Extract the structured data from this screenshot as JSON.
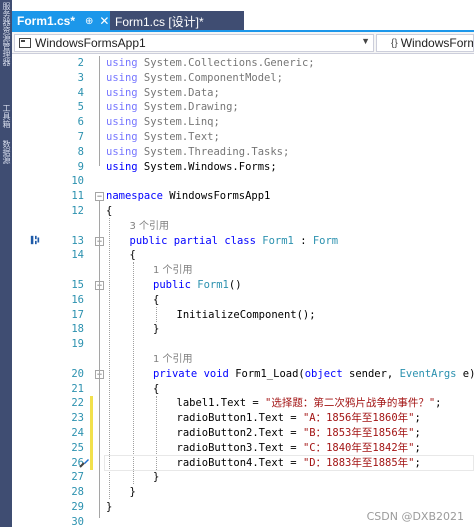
{
  "dock": {
    "labels": [
      "服务器资源管理器",
      "工具箱",
      "数据源"
    ]
  },
  "tabs": [
    {
      "label": "Form1.cs*",
      "pin": "⊕",
      "close": "✕",
      "active": true
    },
    {
      "label": "Form1.cs [设计]*",
      "active": false
    }
  ],
  "navbar": {
    "project": "WindowsFormsApp1",
    "type": "WindowsFormsApp1"
  },
  "code": {
    "lines": [
      {
        "n": "2",
        "kind": "using",
        "kw": "using",
        "rest": " System.Collections.Generic;"
      },
      {
        "n": "3",
        "kind": "using",
        "kw": "using",
        "rest": " System.ComponentModel;"
      },
      {
        "n": "4",
        "kind": "using",
        "kw": "using",
        "rest": " System.Data;"
      },
      {
        "n": "5",
        "kind": "using",
        "kw": "using",
        "rest": " System.Drawing;"
      },
      {
        "n": "6",
        "kind": "using",
        "kw": "using",
        "rest": " System.Linq;"
      },
      {
        "n": "7",
        "kind": "using",
        "kw": "using",
        "rest": " System.Text;"
      },
      {
        "n": "8",
        "kind": "using",
        "kw": "using",
        "rest": " System.Threading.Tasks;"
      },
      {
        "n": "9",
        "kind": "using-active",
        "kw": "using",
        "rest": " System.Windows.Forms;"
      },
      {
        "n": "10",
        "kind": "blank"
      },
      {
        "n": "11",
        "kind": "namespace",
        "kw": "namespace",
        "rest": " WindowsFormsApp1"
      },
      {
        "n": "12",
        "kind": "text",
        "indent": 0,
        "text": "{"
      },
      {
        "n": "",
        "kind": "lens",
        "indent": 1,
        "text": "3 个引用"
      },
      {
        "n": "13",
        "kind": "class",
        "indent": 1,
        "kw": "public partial class",
        "name": "Form1",
        "sep": " : ",
        "base": "Form"
      },
      {
        "n": "14",
        "kind": "text",
        "indent": 1,
        "text": "{"
      },
      {
        "n": "",
        "kind": "lens",
        "indent": 2,
        "text": "1 个引用"
      },
      {
        "n": "15",
        "kind": "ctor",
        "indent": 2,
        "kw": "public",
        "name": "Form1",
        "rest": "()"
      },
      {
        "n": "16",
        "kind": "text",
        "indent": 2,
        "text": "{"
      },
      {
        "n": "17",
        "kind": "text",
        "indent": 3,
        "text": "InitializeComponent();"
      },
      {
        "n": "18",
        "kind": "text",
        "indent": 2,
        "text": "}"
      },
      {
        "n": "19",
        "kind": "blank"
      },
      {
        "n": "",
        "kind": "lens",
        "indent": 2,
        "text": "1 个引用"
      },
      {
        "n": "20",
        "kind": "method",
        "indent": 2,
        "kw1": "private",
        "kw2": "void",
        "name": "Form1_Load(",
        "kw3": "object",
        "mid": " sender, ",
        "ty": "EventArgs",
        "end": " e)"
      },
      {
        "n": "21",
        "kind": "text",
        "indent": 2,
        "text": "{"
      },
      {
        "n": "22",
        "kind": "assign",
        "indent": 3,
        "lhs": "label1.Text = ",
        "str": "\"选择题：第二次鸦片战争的事件？\"",
        "end": ";"
      },
      {
        "n": "23",
        "kind": "assign",
        "indent": 3,
        "lhs": "radioButton1.Text = ",
        "str": "\"A：1856年至1860年\"",
        "end": ";"
      },
      {
        "n": "24",
        "kind": "assign",
        "indent": 3,
        "lhs": "radioButton2.Text = ",
        "str": "\"B：1853年至1856年\"",
        "end": ";"
      },
      {
        "n": "25",
        "kind": "assign",
        "indent": 3,
        "lhs": "radioButton3.Text = ",
        "str": "\"C：1840年至1842年\"",
        "end": ";"
      },
      {
        "n": "26",
        "kind": "assign",
        "indent": 3,
        "lhs": "radioButton4.Text = ",
        "str": "\"D：1883年至1885年\"",
        "end": ";"
      },
      {
        "n": "27",
        "kind": "text",
        "indent": 2,
        "text": "}"
      },
      {
        "n": "28",
        "kind": "text",
        "indent": 1,
        "text": "}"
      },
      {
        "n": "29",
        "kind": "text",
        "indent": 0,
        "text": "}"
      },
      {
        "n": "30",
        "kind": "blank"
      }
    ]
  },
  "watermark": "CSDN @DXB2021",
  "colors": {
    "accent": "#1c97ea",
    "keyword": "#0000ff",
    "type": "#2b91af",
    "string": "#a31515",
    "line_number": "#2b91af",
    "inactive_tab": "#3f4d72"
  }
}
